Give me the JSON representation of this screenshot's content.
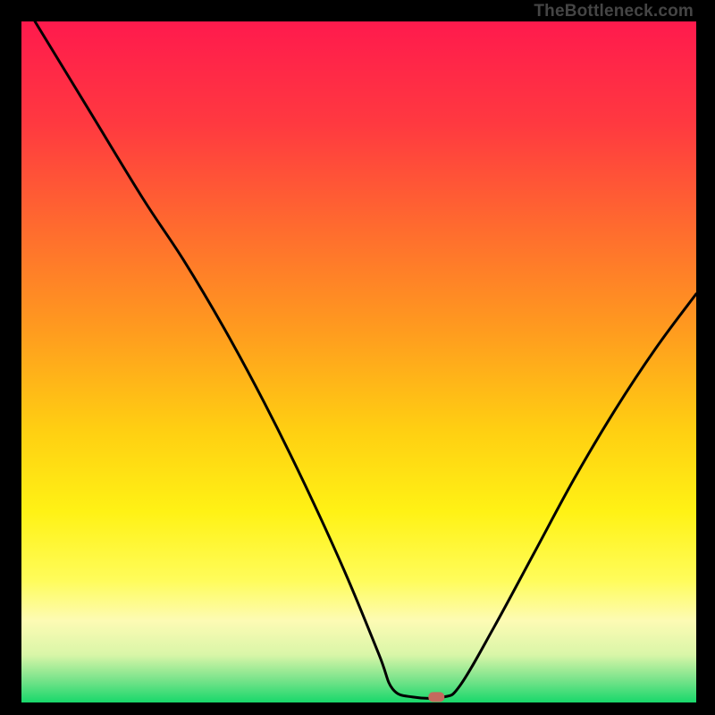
{
  "watermark": "TheBottleneck.com",
  "chart_data": {
    "type": "line",
    "title": "",
    "xlabel": "",
    "ylabel": "",
    "xlim": [
      0,
      100
    ],
    "ylim": [
      0,
      100
    ],
    "grid": false,
    "series": [
      {
        "name": "curve",
        "points": [
          {
            "x": 2,
            "y": 100
          },
          {
            "x": 10,
            "y": 87
          },
          {
            "x": 18,
            "y": 74
          },
          {
            "x": 24,
            "y": 65
          },
          {
            "x": 30,
            "y": 55
          },
          {
            "x": 36,
            "y": 44
          },
          {
            "x": 42,
            "y": 32
          },
          {
            "x": 48,
            "y": 19
          },
          {
            "x": 53,
            "y": 7
          },
          {
            "x": 55,
            "y": 2
          },
          {
            "x": 58,
            "y": 0.8
          },
          {
            "x": 62.5,
            "y": 0.8
          },
          {
            "x": 65,
            "y": 2.5
          },
          {
            "x": 70,
            "y": 11
          },
          {
            "x": 76,
            "y": 22
          },
          {
            "x": 82,
            "y": 33
          },
          {
            "x": 88,
            "y": 43
          },
          {
            "x": 94,
            "y": 52
          },
          {
            "x": 100,
            "y": 60
          }
        ]
      }
    ],
    "marker": {
      "x": 61.5,
      "y": 0.8
    },
    "gradient_stops": [
      {
        "offset": 0.0,
        "color": "#ff1a4d"
      },
      {
        "offset": 0.15,
        "color": "#ff3940"
      },
      {
        "offset": 0.3,
        "color": "#ff6a2f"
      },
      {
        "offset": 0.45,
        "color": "#ff9a1f"
      },
      {
        "offset": 0.6,
        "color": "#ffcf12"
      },
      {
        "offset": 0.72,
        "color": "#fff215"
      },
      {
        "offset": 0.82,
        "color": "#fffc5a"
      },
      {
        "offset": 0.88,
        "color": "#fdfbb4"
      },
      {
        "offset": 0.93,
        "color": "#d9f6a8"
      },
      {
        "offset": 0.965,
        "color": "#7de48c"
      },
      {
        "offset": 1.0,
        "color": "#18d86b"
      }
    ]
  }
}
